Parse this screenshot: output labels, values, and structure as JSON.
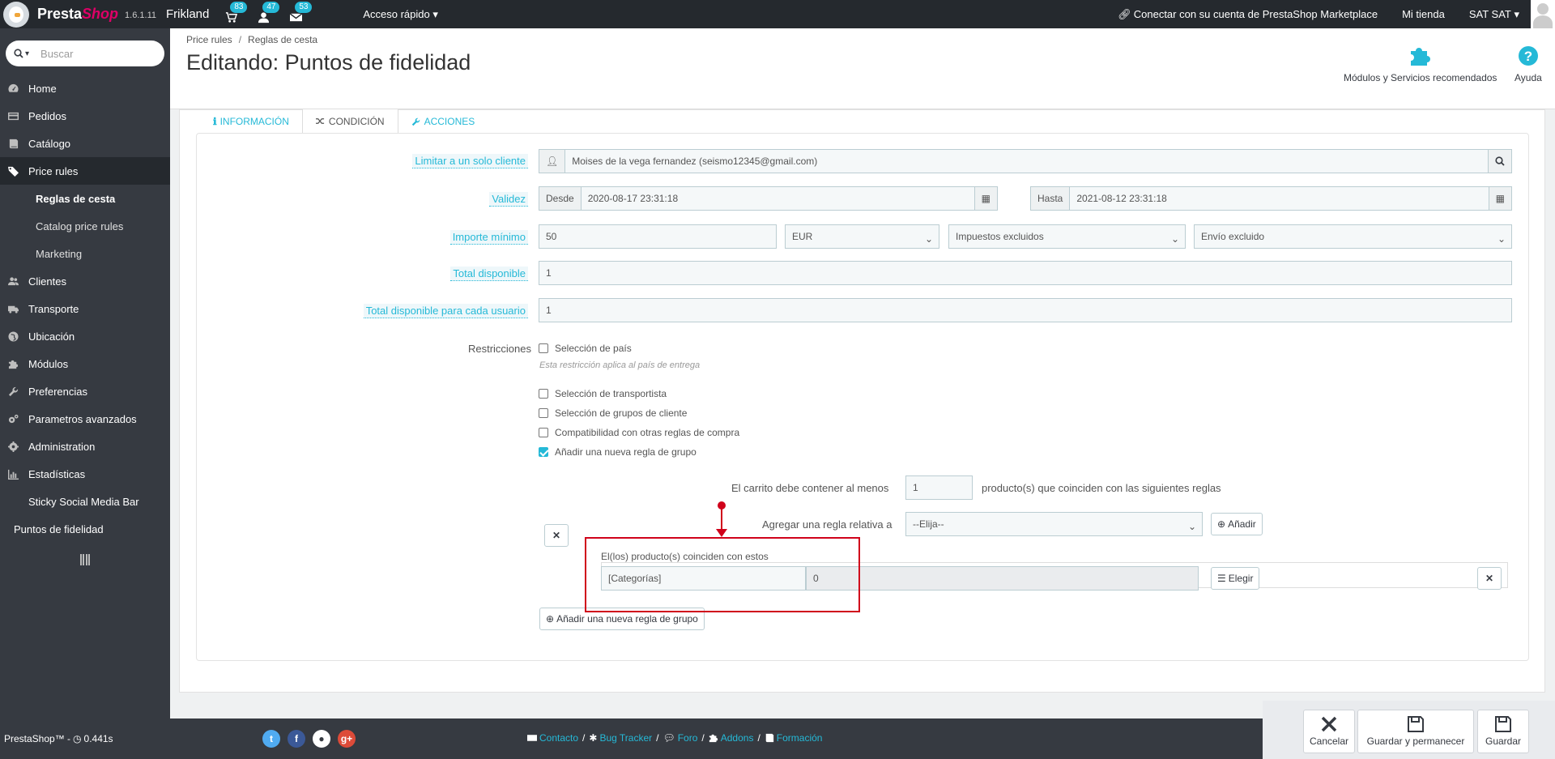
{
  "topbar": {
    "brand_presta": "Presta",
    "brand_shop": "Shop",
    "version": "1.6.1.11",
    "shop_name": "Frikland",
    "orders_badge": "83",
    "customers_badge": "47",
    "messages_badge": "53",
    "quick_access": "Acceso rápido",
    "marketplace": "Conectar con su cuenta de PrestaShop Marketplace",
    "my_shop": "Mi tienda",
    "user": "SAT SAT"
  },
  "sidebar": {
    "search_placeholder": "Buscar",
    "items": [
      {
        "label": "Home",
        "icon": "dashboard-icon"
      },
      {
        "label": "Pedidos",
        "icon": "credit-card-icon"
      },
      {
        "label": "Catálogo",
        "icon": "book-icon"
      },
      {
        "label": "Price rules",
        "icon": "tags-icon"
      },
      {
        "label": "Clientes",
        "icon": "users-icon"
      },
      {
        "label": "Transporte",
        "icon": "truck-icon"
      },
      {
        "label": "Ubicación",
        "icon": "globe-icon"
      },
      {
        "label": "Módulos",
        "icon": "puzzle-icon"
      },
      {
        "label": "Preferencias",
        "icon": "wrench-icon"
      },
      {
        "label": "Parametros avanzados",
        "icon": "cogs-icon"
      },
      {
        "label": "Administration",
        "icon": "cog-icon"
      },
      {
        "label": "Estadísticas",
        "icon": "bar-chart-icon"
      },
      {
        "label": "Sticky Social Media Bar",
        "icon": ""
      },
      {
        "label": "Puntos de fidelidad",
        "icon": ""
      }
    ],
    "subitems": [
      "Reglas de cesta",
      "Catalog price rules",
      "Marketing"
    ],
    "footer_text": "PrestaShop™ - ",
    "load_time": "0.441s"
  },
  "header": {
    "breadcrumb": [
      "Price rules",
      "Reglas de cesta"
    ],
    "title": "Editando: Puntos de fidelidad",
    "modules_label": "Módulos y Servicios recomendados",
    "help_label": "Ayuda"
  },
  "tabs": [
    "INFORMACIÓN",
    "CONDICIÓN",
    "ACCIONES"
  ],
  "form": {
    "customer_label": "Limitar a un solo cliente",
    "customer_value": "Moises de la vega fernandez (seismo12345@gmail.com)",
    "validity_label": "Validez",
    "from_label": "Desde",
    "from_value": "2020-08-17 23:31:18",
    "to_label": "Hasta",
    "to_value": "2021-08-12 23:31:18",
    "min_amount_label": "Importe mínimo",
    "min_amount_value": "50",
    "currency": "EUR",
    "tax": "Impuestos excluidos",
    "shipping": "Envío excluido",
    "total_label": "Total disponible",
    "total_value": "1",
    "per_user_label": "Total disponible para cada usuario",
    "per_user_value": "1",
    "restrictions_label": "Restricciones",
    "country": "Selección de país",
    "country_help": "Esta restricción aplica al país de entrega",
    "carrier": "Selección de transportista",
    "groups": "Selección de grupos de cliente",
    "compat": "Compatibilidad con otras reglas de compra",
    "add_group_rule": "Añadir una nueva regla de grupo",
    "cart_contains_pre": "El carrito debe contener al menos",
    "cart_qty": "1",
    "cart_contains_post": "producto(s) que coinciden con las siguientes reglas",
    "add_rule_label": "Agregar una regla relativa a",
    "add_rule_select": "--Elija--",
    "add_button": "Añadir",
    "match_label": "El(los) producto(s) coinciden con estos",
    "category_label": "[Categorías]",
    "category_value": "0",
    "choose_button": "Elegir",
    "new_group_button": "Añadir una nueva regla de grupo"
  },
  "footer": {
    "links": [
      "Contacto",
      "Bug Tracker",
      "Foro",
      "Addons",
      "Formación"
    ],
    "cancel": "Cancelar",
    "save_stay": "Guardar y permanecer",
    "save": "Guardar"
  },
  "colors": {
    "accent": "#25b9d7",
    "sidebar": "#363a41",
    "highlight": "#d0021b"
  }
}
